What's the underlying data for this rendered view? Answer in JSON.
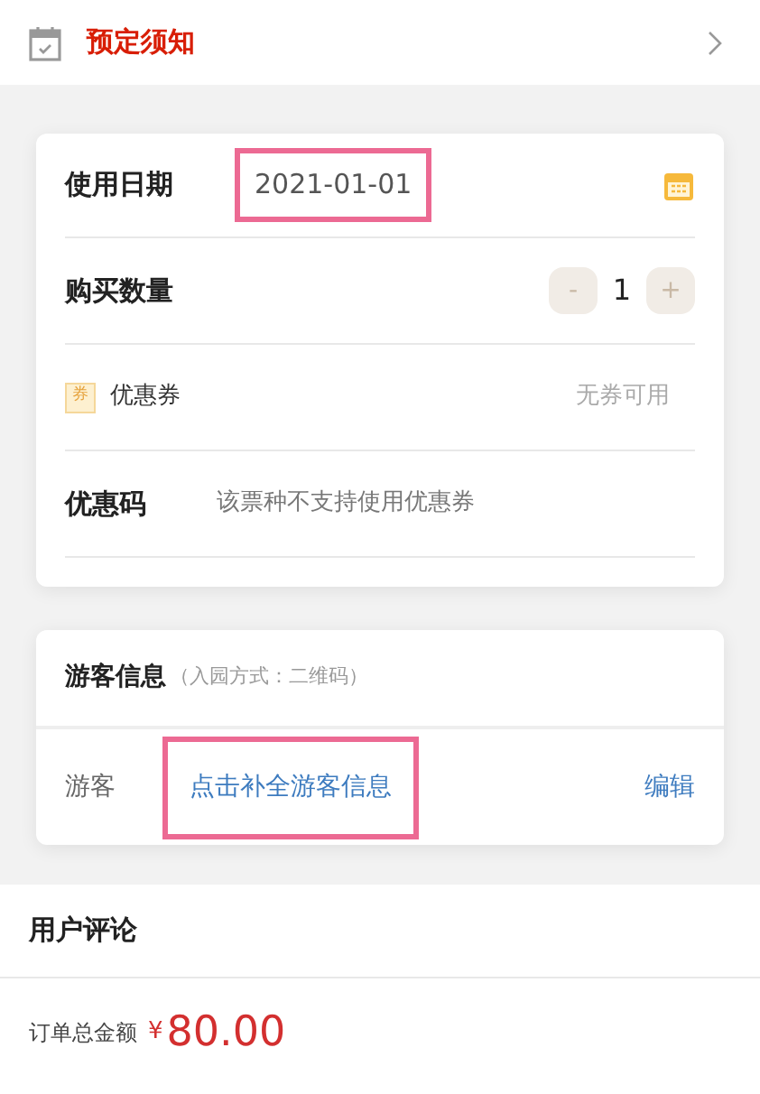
{
  "notice": {
    "title": "预定须知"
  },
  "order_card": {
    "date": {
      "label": "使用日期",
      "value": "2021-01-01",
      "highlighted": true
    },
    "quantity": {
      "label": "购买数量",
      "minus": "-",
      "value": "1",
      "plus": "+"
    },
    "coupon": {
      "icon_text": "券",
      "label": "优惠券",
      "value": "无券可用"
    },
    "promo_code": {
      "label": "优惠码",
      "value": "该票种不支持使用优惠券"
    }
  },
  "visitor_card": {
    "title": "游客信息",
    "note": "（入园方式：二维码）",
    "row": {
      "label": "游客",
      "link": "点击补全游客信息",
      "highlighted": true,
      "action": "编辑"
    }
  },
  "reviews": {
    "title": "用户评论"
  },
  "footer": {
    "total_label": "订单总金额",
    "currency": "¥",
    "amount": "80.00"
  }
}
